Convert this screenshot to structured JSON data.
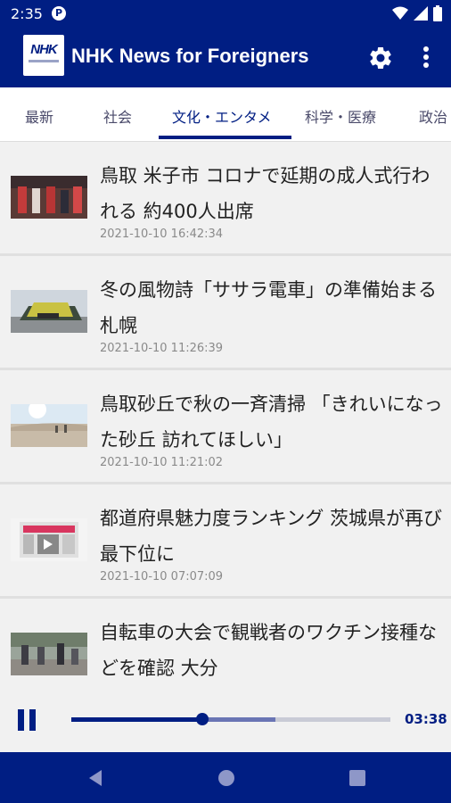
{
  "status_bar": {
    "time": "2:35",
    "notification_icon": "P"
  },
  "app_bar": {
    "logo_text": "NHK",
    "title": "NHK News for Foreigners",
    "settings_icon": "gear-icon",
    "more_icon": "more-vert-icon"
  },
  "tabs": [
    {
      "label": "最新"
    },
    {
      "label": "社会"
    },
    {
      "label": "文化・エンタメ",
      "active": true
    },
    {
      "label": "科学・医療"
    },
    {
      "label": "政治"
    }
  ],
  "articles": [
    {
      "title": "鳥取 米子市 コロナで延期の成人式行われる 約400人出席",
      "date": "2021-10-10 16:42:34"
    },
    {
      "title": "冬の風物詩「ササラ電車」の準備始まる 札幌",
      "date": "2021-10-10 11:26:39"
    },
    {
      "title": "鳥取砂丘で秋の一斉清掃 「きれいになった砂丘 訪れてほしい」",
      "date": "2021-10-10 11:21:02"
    },
    {
      "title": "都道府県魅力度ランキング 茨城県が再び最下位に",
      "date": "2021-10-10 07:07:09"
    },
    {
      "title": "自転車の大会で観戦者のワクチン接種などを確認 大分",
      "date": ""
    }
  ],
  "player": {
    "time": "03:38",
    "progress": 0.41,
    "buffered": 0.64
  },
  "colors": {
    "primary": "#001e83",
    "background": "#f1f1f1"
  }
}
